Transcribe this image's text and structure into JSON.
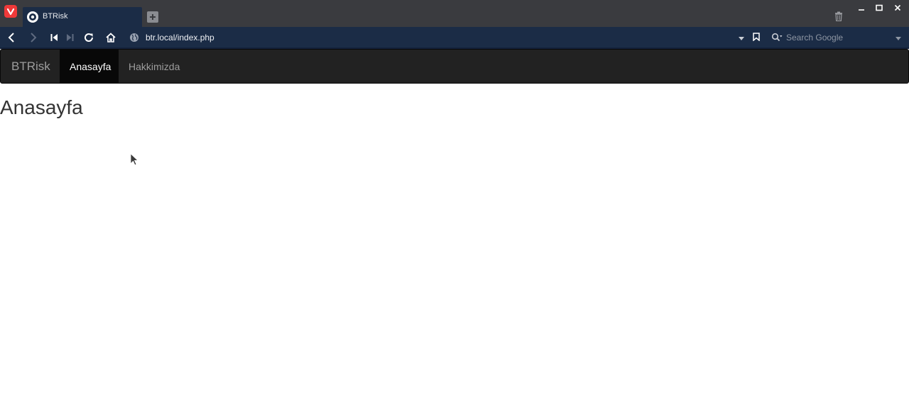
{
  "browser": {
    "tab": {
      "title": "BTRisk"
    },
    "address": {
      "url": "btr.local/index.php"
    },
    "search": {
      "placeholder": "Search Google"
    },
    "colors": {
      "chrome": "#3a3b3f",
      "toolbar": "#1b2c46",
      "accent": "#ef3939"
    }
  },
  "site": {
    "brand": "BTRisk",
    "nav": [
      {
        "label": "Anasayfa",
        "active": true
      },
      {
        "label": "Hakkimizda",
        "active": false
      }
    ],
    "heading": "Anasayfa",
    "colors": {
      "navbar": "#222222",
      "active_item": "#080808",
      "text": "#333333"
    }
  }
}
